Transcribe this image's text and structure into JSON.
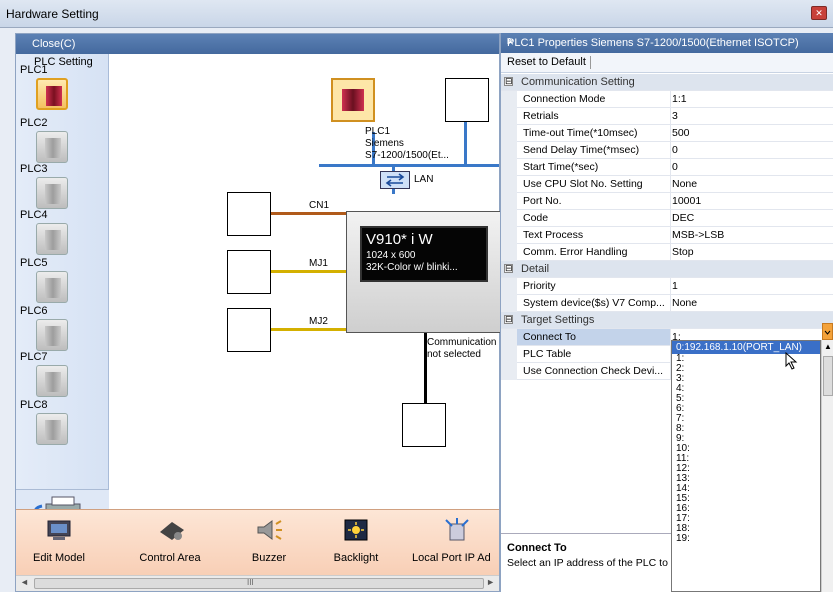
{
  "window": {
    "title": "Hardware Setting"
  },
  "left": {
    "close_label": "Close(C)",
    "setting_header": "PLC Setting",
    "plcs": [
      "PLC1",
      "PLC2",
      "PLC3",
      "PLC4",
      "PLC5",
      "PLC6",
      "PLC7",
      "PLC8"
    ]
  },
  "diagram": {
    "plc1_name": "PLC1",
    "plc1_maker": "Siemens",
    "plc1_model": "S7-1200/1500(Et...",
    "lan_label": "LAN",
    "cn1": "CN1",
    "mj1": "MJ1",
    "mj2": "MJ2",
    "hmi_model": "V910* i W",
    "hmi_res": "1024 x 600",
    "hmi_color": "32K-Color w/  blinki...",
    "comm_line1": "Communication",
    "comm_line2": "not selected"
  },
  "toolbar": {
    "items": [
      "Edit Model",
      "Control Area",
      "Buzzer",
      "Backlight",
      "Local Port IP Ad"
    ]
  },
  "scroll_arrow_left": "◄",
  "scroll_arrow_right": "►",
  "scroll_grip": "III",
  "right": {
    "title": "PLC1 Properties Siemens S7-1200/1500(Ethernet ISOTCP)",
    "pin": "ᵖ",
    "close": "×",
    "reset": "Reset to Default",
    "sections": {
      "comm": "Communication Setting",
      "detail": "Detail",
      "target": "Target Settings"
    },
    "toggle": "⊟",
    "rows": [
      {
        "name": "Connection Mode",
        "value": "1:1"
      },
      {
        "name": "Retrials",
        "value": "3"
      },
      {
        "name": "Time-out Time(*10msec)",
        "value": "500"
      },
      {
        "name": "Send Delay Time(*msec)",
        "value": "0"
      },
      {
        "name": "Start Time(*sec)",
        "value": "0"
      },
      {
        "name": "Use CPU Slot No. Setting",
        "value": "None"
      },
      {
        "name": "Port No.",
        "value": "10001"
      },
      {
        "name": "Code",
        "value": "DEC"
      },
      {
        "name": "Text Process",
        "value": "MSB->LSB"
      },
      {
        "name": "Comm. Error Handling",
        "value": "Stop"
      }
    ],
    "detail_rows": [
      {
        "name": "Priority",
        "value": "1"
      },
      {
        "name": "System device($s) V7 Comp...",
        "value": "None"
      }
    ],
    "target_rows": [
      {
        "name": "Connect To",
        "value": "1:"
      },
      {
        "name": "PLC Table",
        "value": ""
      },
      {
        "name": "Use Connection Check Devi...",
        "value": ""
      }
    ],
    "desc_title": "Connect To",
    "desc_text": "Select an IP address of the PLC to c"
  },
  "dropdown": {
    "options": [
      "0:192.168.1.10(PORT_LAN)",
      "1:",
      "2:",
      "3:",
      "4:",
      "5:",
      "6:",
      "7:",
      "8:",
      "9:",
      "10:",
      "11:",
      "12:",
      "13:",
      "14:",
      "15:",
      "16:",
      "17:",
      "18:",
      "19:"
    ]
  },
  "colors": {
    "accent": "#44699e",
    "highlight": "#3a6fc7",
    "lan": "#3a78c8",
    "cn1": "#b05a1a",
    "mj": "#d4b000"
  }
}
